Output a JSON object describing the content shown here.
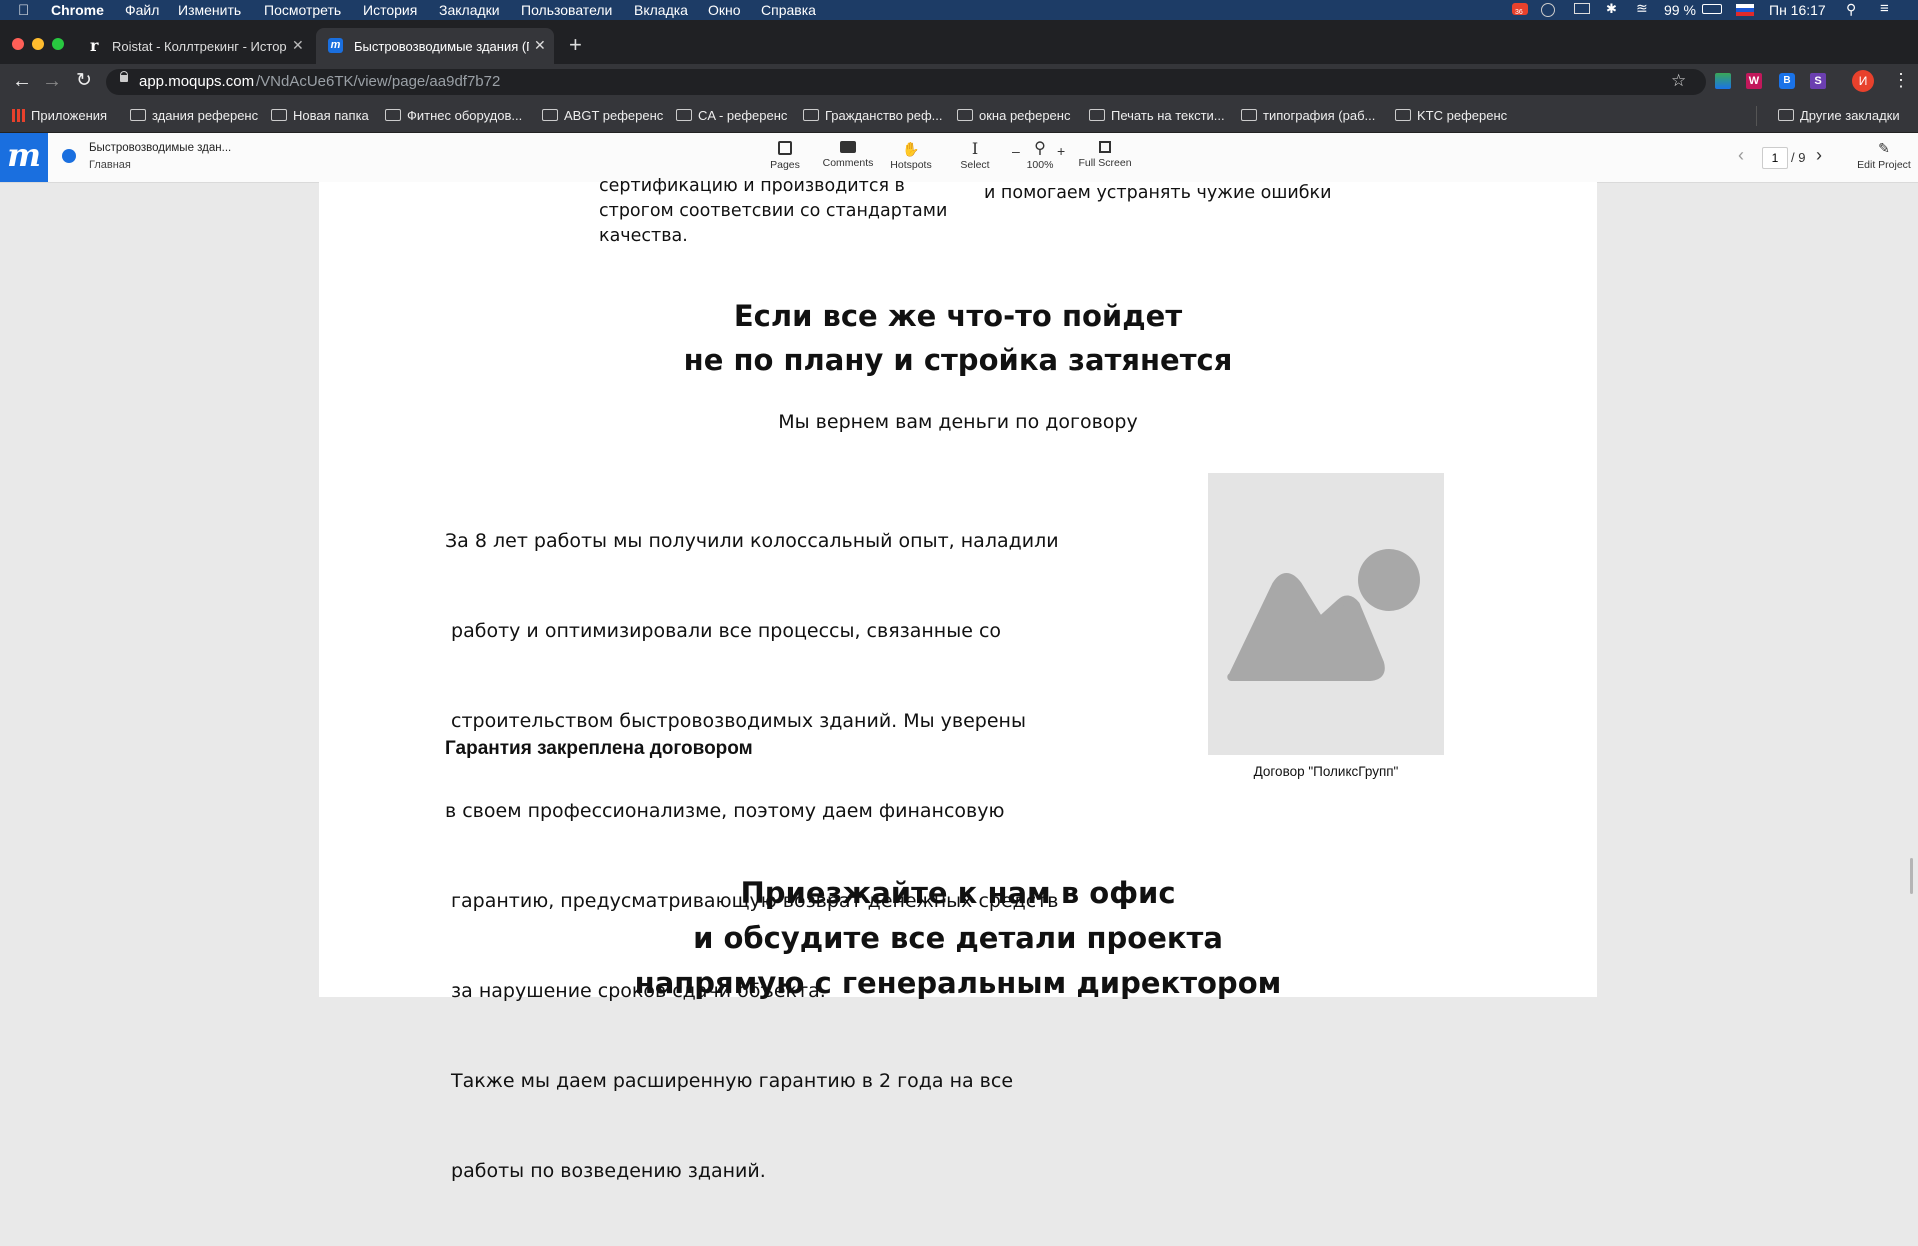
{
  "menubar": {
    "app": "Chrome",
    "items": [
      "Файл",
      "Изменить",
      "Посмотреть",
      "История",
      "Закладки",
      "Пользователи",
      "Вкладка",
      "Окно",
      "Справка"
    ],
    "battery": "99 %",
    "clock": "Пн 16:17",
    "badge": "36"
  },
  "tabs": [
    {
      "title": "Roistat - Коллтрекинг - Истор"
    },
    {
      "title": "Быстровозводимые здания (Г"
    }
  ],
  "address": {
    "host": "app.moqups.com",
    "path": "/VNdAcUe6TK/view/page/aa9df7b72"
  },
  "bookmarks": {
    "apps": "Приложения",
    "items": [
      "здания референс",
      "Новая папка",
      "Фитнес оборудов...",
      "ABGT референс",
      "CA - референс",
      "Гражданство реф...",
      "окна референс",
      "Печать на тексти...",
      "типография (раб...",
      "KTC референс"
    ],
    "other": "Другие закладки"
  },
  "moqups": {
    "logo": "m",
    "project_title": "Быстровозводимые здан...",
    "page_name": "Главная",
    "tools": {
      "pages": "Pages",
      "comments": "Comments",
      "hotspots": "Hotspots",
      "select": "Select",
      "zoom": "100%",
      "fullscreen": "Full Screen"
    },
    "pager": {
      "current": "1",
      "total": "/ 9"
    },
    "edit": "Edit Project"
  },
  "content": {
    "top_left": [
      "сертификацию и производится в",
      "строгом соответсвии со стандартами",
      "качества."
    ],
    "top_right": [
      "и помогаем устранять чужие ошибки"
    ],
    "heading1": [
      "Если все же что-то пойдет",
      "не по плану и стройка затянется"
    ],
    "subtitle": "Мы вернем вам деньги по договору",
    "paragraph": [
      "За 8 лет работы мы получили колоссальный опыт, наладили",
      " работу и оптимизировали все процессы, связанные со",
      " строительством быстровозводимых зданий. Мы уверены",
      "в своем профессионализме, поэтому даем финансовую",
      " гарантию, предусматривающую возврат денежных средств",
      " за нарушение сроков сдачи объекта.",
      " Также мы даем расширенную гарантию в 2 года на все",
      " работы по возведению зданий."
    ],
    "guarantee": "Гарантия закреплена договором",
    "image_caption": "Договор \"ПоликсГрупп\"",
    "heading2": [
      "Приезжайте к нам в офис",
      "и обсудите все детали проекта",
      "напрямую с генеральным директором"
    ]
  },
  "colors": {
    "menubar": "#1d3c66",
    "tabstrip": "#202124",
    "toolbar": "#35363a",
    "moqups_blue": "#1a6fdf",
    "avatar": "#e8412c",
    "placeholder_bg": "#e4e4e4",
    "placeholder_shape": "#a8a8a8"
  }
}
